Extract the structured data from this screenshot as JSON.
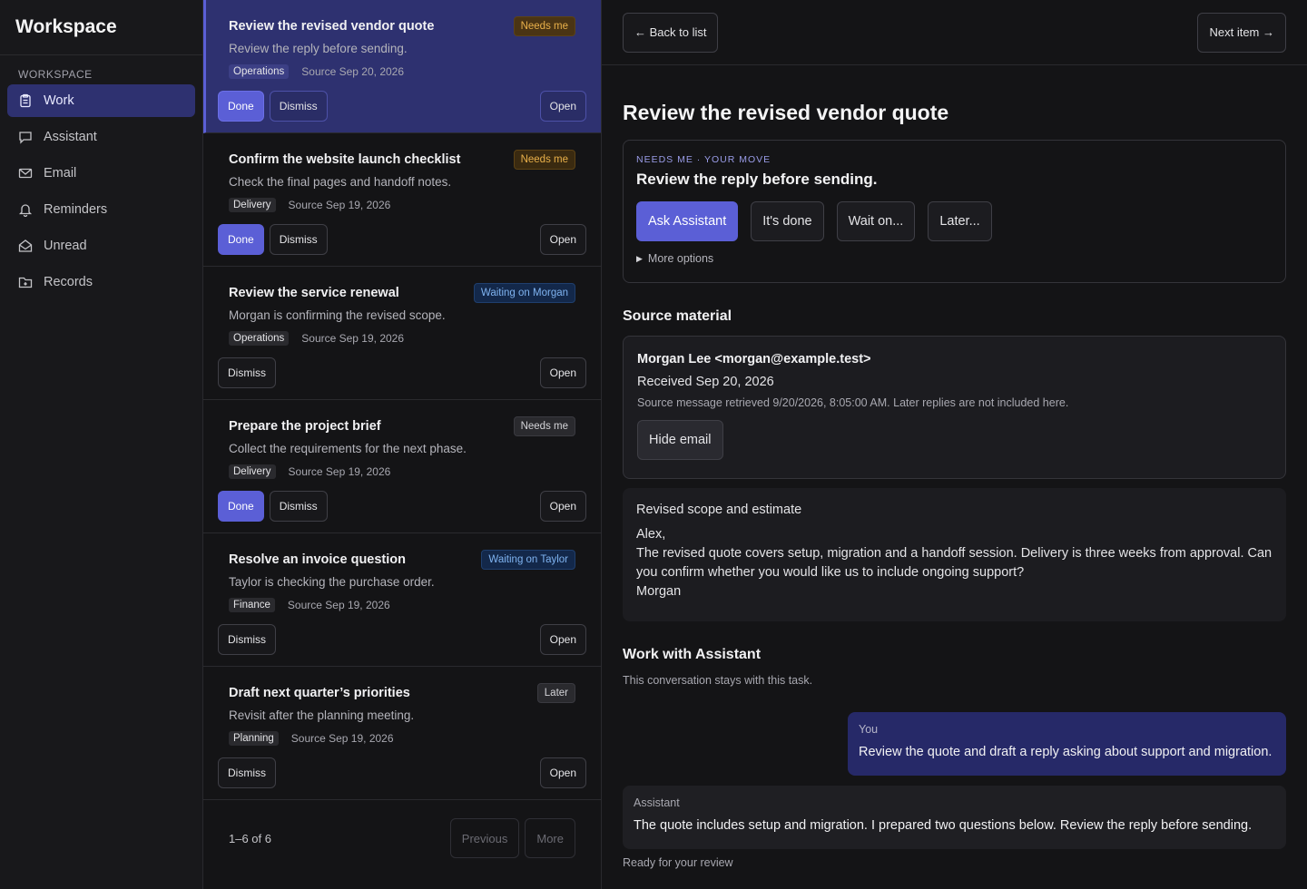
{
  "sidebar": {
    "brand": "Workspace",
    "section": "WORKSPACE",
    "items": [
      {
        "label": "Work",
        "icon": "clipboard-icon",
        "active": true
      },
      {
        "label": "Assistant",
        "icon": "chat-icon"
      },
      {
        "label": "Email",
        "icon": "mail-icon"
      },
      {
        "label": "Reminders",
        "icon": "bell-icon"
      },
      {
        "label": "Unread",
        "icon": "envelope-open-icon"
      },
      {
        "label": "Records",
        "icon": "folder-icon"
      }
    ]
  },
  "list": {
    "cards": [
      {
        "title": "Review the revised vendor quote",
        "summary": "Review the reply before sending.",
        "tag": "Operations",
        "source": "Source Sep 20, 2026",
        "badge": "Needs me",
        "done": "Done",
        "dismiss": "Dismiss",
        "open": "Open"
      },
      {
        "title": "Confirm the website launch checklist",
        "summary": "Check the final pages and handoff notes.",
        "tag": "Delivery",
        "source": "Source Sep 19, 2026",
        "badge": "Needs me",
        "done": "Done",
        "dismiss": "Dismiss",
        "open": "Open"
      },
      {
        "title": "Review the service renewal",
        "summary": "Morgan is confirming the revised scope.",
        "tag": "Operations",
        "source": "Source Sep 19, 2026",
        "badge": "Waiting on Morgan",
        "dismiss": "Dismiss",
        "open": "Open"
      },
      {
        "title": "Prepare the project brief",
        "summary": "Collect the requirements for the next phase.",
        "tag": "Delivery",
        "source": "Source Sep 19, 2026",
        "badge": "Needs me",
        "done": "Done",
        "dismiss": "Dismiss",
        "open": "Open"
      },
      {
        "title": "Resolve an invoice question",
        "summary": "Taylor is checking the purchase order.",
        "tag": "Finance",
        "source": "Source Sep 19, 2026",
        "badge": "Waiting on Taylor",
        "dismiss": "Dismiss",
        "open": "Open"
      },
      {
        "title": "Draft next quarter’s priorities",
        "summary": "Revisit after the planning meeting.",
        "tag": "Planning",
        "source": "Source Sep 19, 2026",
        "badge": "Later",
        "dismiss": "Dismiss",
        "open": "Open"
      }
    ],
    "pager": {
      "count": "1–6 of 6",
      "previous": "Previous",
      "more": "More"
    }
  },
  "detail": {
    "back": "← Back to list",
    "next": "Next item →",
    "title": "Review the revised vendor quote",
    "move": {
      "kicker": "NEEDS ME · YOUR MOVE",
      "headline": "Review the reply before sending.",
      "actions": [
        "Ask Assistant",
        "It's done",
        "Wait on...",
        "Later..."
      ],
      "more": "More options"
    },
    "source": {
      "heading": "Source material",
      "from": "Morgan Lee <morgan@example.test>",
      "received": "Received Sep 20, 2026",
      "note": "Source message retrieved 9/20/2026, 8:05:00 AM. Later replies are not included here.",
      "hide": "Hide email",
      "subject": "Revised scope and estimate",
      "lines": [
        "Alex,",
        "The revised quote covers setup, migration and a handoff session. Delivery is three weeks from approval. Can you confirm whether you would like us to include ongoing support?",
        "Morgan"
      ]
    },
    "work": {
      "heading": "Work with Assistant",
      "sub": "This conversation stays with this task.",
      "you_label": "You",
      "you_text": "Review the quote and draft a reply asking about support and migration.",
      "asst_label": "Assistant",
      "asst_text": "The quote includes setup and migration. I prepared two questions below. Review the reply before sending.",
      "status": "Ready for your review"
    }
  },
  "colors": {
    "accent": "#5b5fd6",
    "selected": "#2e3170",
    "needs": "#e9b04a",
    "waiting": "#7fb3f0"
  }
}
